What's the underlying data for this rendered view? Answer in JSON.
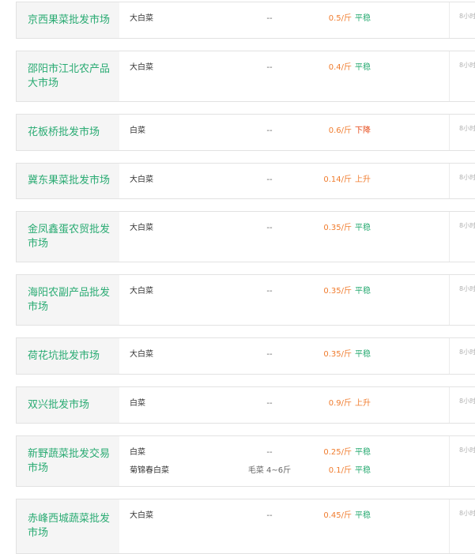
{
  "listings": [
    {
      "market": "京西果菜批发市场",
      "rows": [
        {
          "variety": "大白菜",
          "spec": "--",
          "price": "0.5/斤",
          "trend": "平稳",
          "trend_type": "flat"
        }
      ],
      "time": "8小时"
    },
    {
      "market": "邵阳市江北农产品大市场",
      "rows": [
        {
          "variety": "大白菜",
          "spec": "--",
          "price": "0.4/斤",
          "trend": "平稳",
          "trend_type": "flat"
        }
      ],
      "time": "8小时"
    },
    {
      "market": "花板桥批发市场",
      "rows": [
        {
          "variety": "白菜",
          "spec": "--",
          "price": "0.6/斤",
          "trend": "下降",
          "trend_type": "down"
        }
      ],
      "time": "8小时"
    },
    {
      "market": "冀东果菜批发市场",
      "rows": [
        {
          "variety": "大白菜",
          "spec": "--",
          "price": "0.14/斤",
          "trend": "上升",
          "trend_type": "up"
        }
      ],
      "time": "8小时"
    },
    {
      "market": "金凤鑫蛋农贸批发市场",
      "rows": [
        {
          "variety": "大白菜",
          "spec": "--",
          "price": "0.35/斤",
          "trend": "平稳",
          "trend_type": "flat"
        }
      ],
      "time": "8小时"
    },
    {
      "market": "海阳农副产品批发市场",
      "rows": [
        {
          "variety": "大白菜",
          "spec": "--",
          "price": "0.35/斤",
          "trend": "平稳",
          "trend_type": "flat"
        }
      ],
      "time": "8小时"
    },
    {
      "market": "荷花坑批发市场",
      "rows": [
        {
          "variety": "大白菜",
          "spec": "--",
          "price": "0.35/斤",
          "trend": "平稳",
          "trend_type": "flat"
        }
      ],
      "time": "8小时"
    },
    {
      "market": "双兴批发市场",
      "rows": [
        {
          "variety": "白菜",
          "spec": "--",
          "price": "0.9/斤",
          "trend": "上升",
          "trend_type": "up"
        }
      ],
      "time": "8小时"
    },
    {
      "market": "新野蔬菜批发交易市场",
      "rows": [
        {
          "variety": "白菜",
          "spec": "--",
          "price": "0.25/斤",
          "trend": "平稳",
          "trend_type": "flat"
        },
        {
          "variety": "菊锦春白菜",
          "spec": "毛菜 4~6斤",
          "price": "0.1/斤",
          "trend": "平稳",
          "trend_type": "flat"
        }
      ],
      "time": "8小时"
    },
    {
      "market": "赤峰西城蔬菜批发市场",
      "rows": [
        {
          "variety": "大白菜",
          "spec": "--",
          "price": "0.45/斤",
          "trend": "平稳",
          "trend_type": "flat"
        }
      ],
      "time": "8小时"
    }
  ]
}
